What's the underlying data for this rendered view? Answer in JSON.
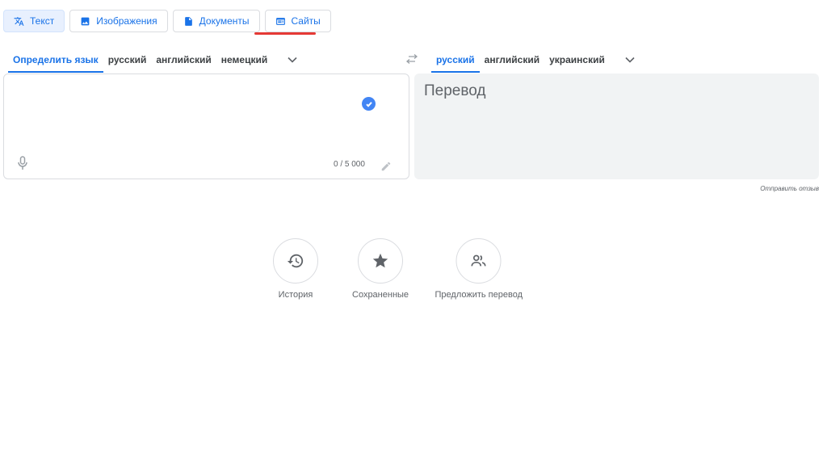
{
  "modes": [
    {
      "label": "Текст",
      "icon": "translate-icon"
    },
    {
      "label": "Изображения",
      "icon": "image-icon"
    },
    {
      "label": "Документы",
      "icon": "document-icon"
    },
    {
      "label": "Сайты",
      "icon": "website-icon"
    }
  ],
  "source_languages": {
    "detect": "Определить язык",
    "items": [
      "русский",
      "английский",
      "немецкий"
    ]
  },
  "target_languages": {
    "items": [
      "русский",
      "английский",
      "украинский"
    ]
  },
  "source": {
    "counter": "0 / 5 000"
  },
  "target": {
    "placeholder": "Перевод"
  },
  "feedback": "Отправить отзыв",
  "actions": [
    {
      "label": "История",
      "icon": "history-icon"
    },
    {
      "label": "Сохраненные",
      "icon": "star-icon"
    },
    {
      "label": "Предложить перевод",
      "icon": "people-icon"
    }
  ],
  "colors": {
    "accent": "#1a73e8",
    "highlight_underline": "#e53935",
    "check_badge": "#4285f4"
  }
}
